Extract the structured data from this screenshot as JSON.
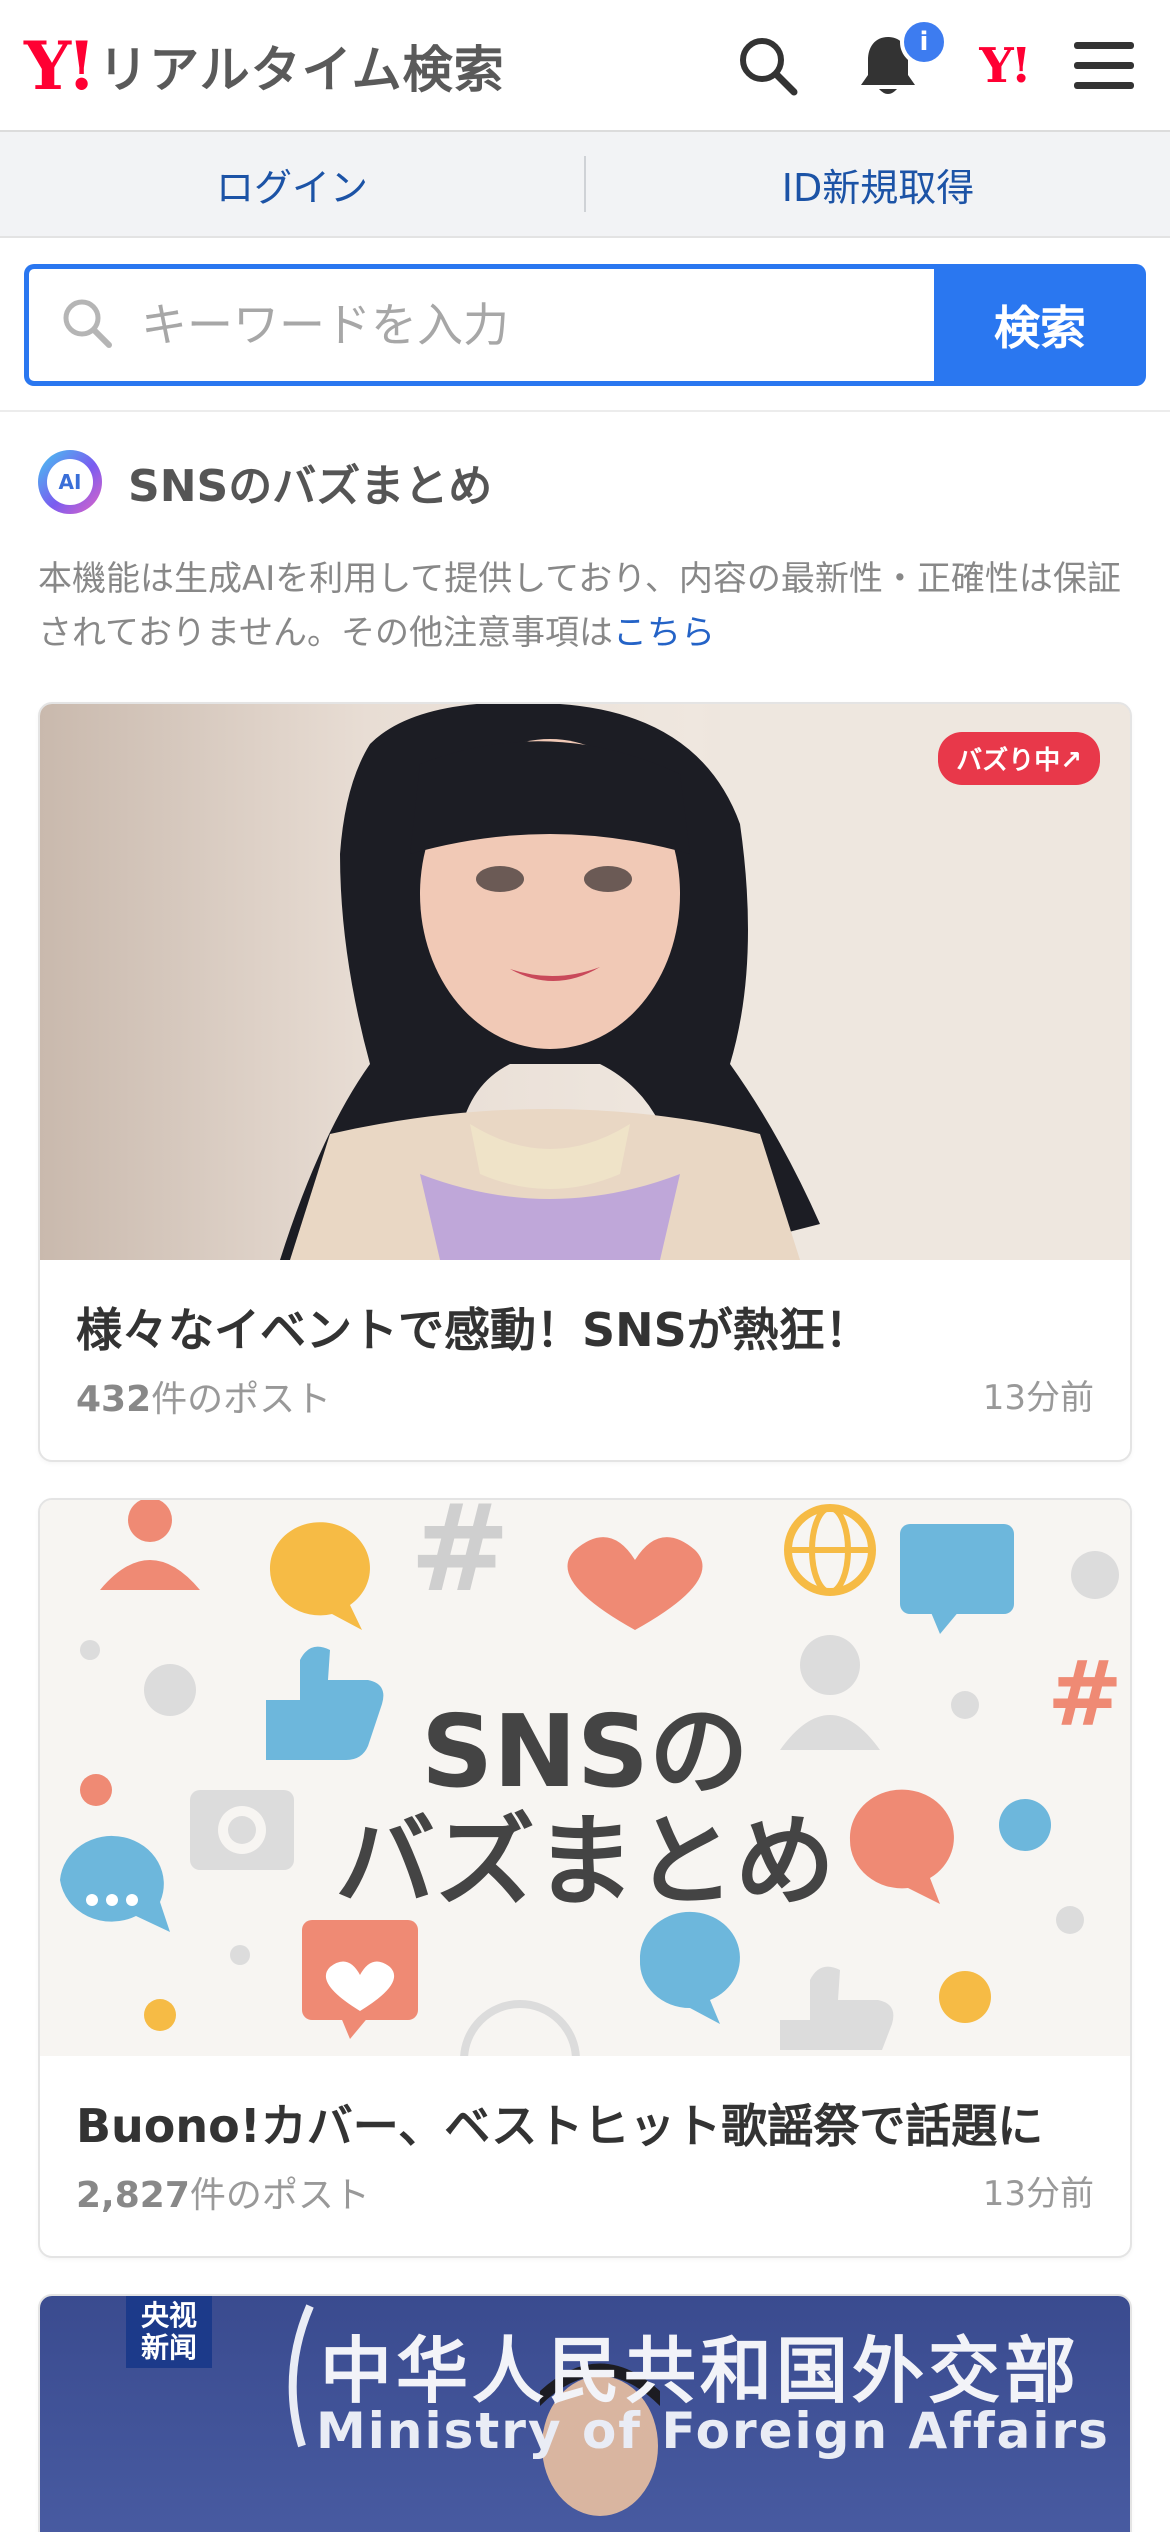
{
  "header": {
    "logo_y": "Y!",
    "logo_text": "リアルタイム検索",
    "notification_badge": "i",
    "yj_label": "Y!"
  },
  "loginbar": {
    "login": "ログイン",
    "signup": "ID新規取得"
  },
  "search": {
    "placeholder": "キーワードを入力",
    "button": "検索"
  },
  "section": {
    "ai_label": "AI",
    "title": "SNSのバズまとめ",
    "notice": "本機能は生成AIを利用して提供しており、内容の最新性・正確性は保証されておりません。その他注意事項は",
    "notice_link": "こちら"
  },
  "cards": [
    {
      "badge": "バズり中↗",
      "title": "様々なイベントで感動！SNSが熱狂！",
      "count": "432",
      "count_suffix": "件のポスト",
      "time": "13分前"
    },
    {
      "image_text_line1": "SNSの",
      "image_text_line2": "バズまとめ",
      "title": "Buono!カバー、ベストヒット歌謡祭で話題に",
      "count": "2,827",
      "count_suffix": "件のポスト",
      "time": "13分前"
    },
    {
      "logo_line1": "央视",
      "logo_line2": "新闻",
      "banner_cn": "中华人民共和国外交部",
      "banner_en": "Ministry of Foreign Affairs"
    }
  ],
  "colors": {
    "brand_red": "#ff0033",
    "accent_blue": "#2a77f0",
    "link_blue": "#1c53a6",
    "buzz_red": "#e8384a"
  }
}
